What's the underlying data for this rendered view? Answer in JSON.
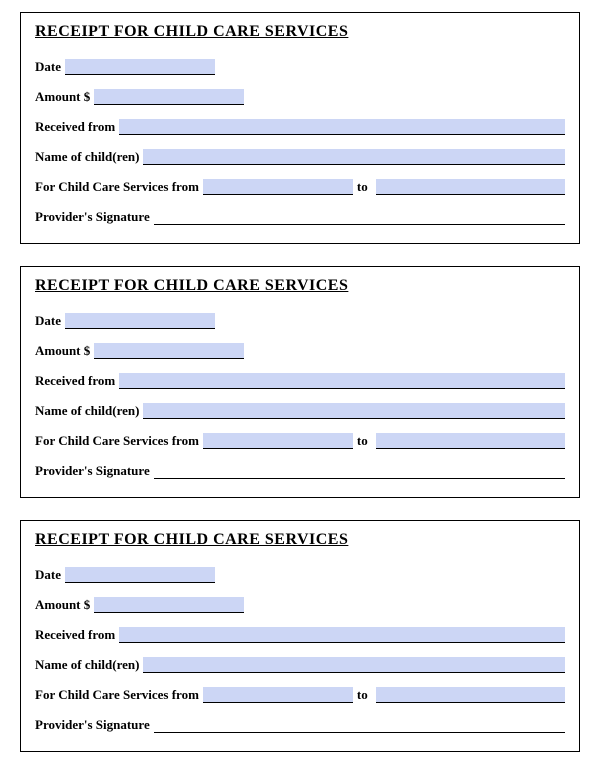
{
  "receipts": [
    {
      "title": "RECEIPT FOR CHILD CARE SERVICES",
      "date_label": "Date",
      "amount_label": "Amount $",
      "received_from_label": "Received from",
      "child_name_label": "Name of child(ren)",
      "services_from_label": "For Child Care Services from",
      "to_label": "to",
      "signature_label": "Provider's Signature",
      "date_value": "",
      "amount_value": "",
      "received_from_value": "",
      "child_name_value": "",
      "services_from_value": "",
      "services_to_value": "",
      "signature_value": ""
    },
    {
      "title": "RECEIPT FOR CHILD CARE SERVICES",
      "date_label": "Date",
      "amount_label": "Amount $",
      "received_from_label": "Received from",
      "child_name_label": "Name of child(ren)",
      "services_from_label": "For Child Care Services from",
      "to_label": "to",
      "signature_label": "Provider's Signature",
      "date_value": "",
      "amount_value": "",
      "received_from_value": "",
      "child_name_value": "",
      "services_from_value": "",
      "services_to_value": "",
      "signature_value": ""
    },
    {
      "title": "RECEIPT FOR CHILD CARE SERVICES",
      "date_label": "Date",
      "amount_label": "Amount $",
      "received_from_label": "Received from",
      "child_name_label": "Name of child(ren)",
      "services_from_label": "For Child Care Services from",
      "to_label": "to",
      "signature_label": "Provider's Signature",
      "date_value": "",
      "amount_value": "",
      "received_from_value": "",
      "child_name_value": "",
      "services_from_value": "",
      "services_to_value": "",
      "signature_value": ""
    }
  ]
}
